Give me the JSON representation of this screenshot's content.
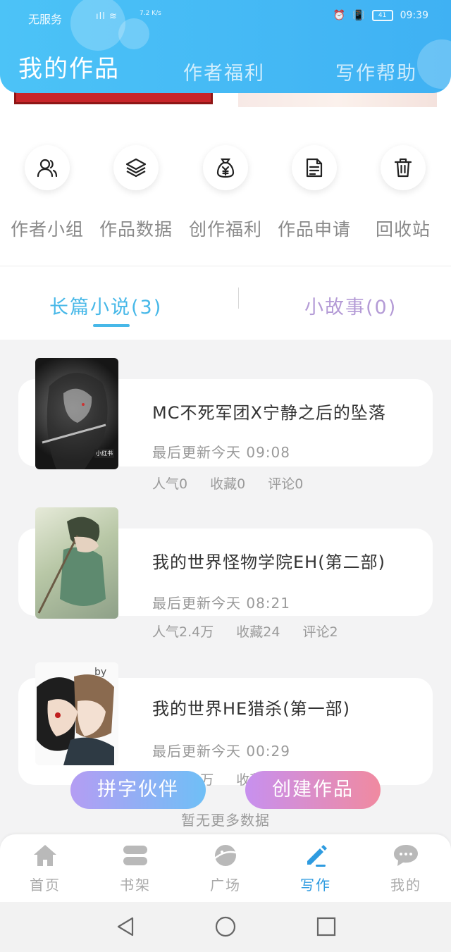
{
  "status_bar": {
    "carrier": "无服务",
    "signal": "ⁿ᯼ ≋",
    "speed": "7.2 K/s",
    "battery": "41",
    "time": "09:39"
  },
  "header": {
    "tabs": [
      "我的作品",
      "作者福利",
      "写作帮助"
    ],
    "active_tab": 0
  },
  "shortcuts": [
    {
      "label": "作者小组",
      "icon": "users-icon"
    },
    {
      "label": "作品数据",
      "icon": "layers-icon"
    },
    {
      "label": "创作福利",
      "icon": "money-bag-icon"
    },
    {
      "label": "作品申请",
      "icon": "document-icon"
    },
    {
      "label": "回收站",
      "icon": "trash-icon"
    }
  ],
  "type_tabs": {
    "long": "长篇小说(3)",
    "short": "小故事(0)",
    "active": "long"
  },
  "works": [
    {
      "title": "MC不死军团X宁静之后的坠落",
      "updated": "最后更新今天 09:08",
      "popularity": "人气0",
      "favorites": "收藏0",
      "comments": "评论0",
      "cover_tag": "小红书"
    },
    {
      "title": "我的世界怪物学院EH(第二部)",
      "updated": "最后更新今天 08:21",
      "popularity": "人气2.4万",
      "favorites": "收藏24",
      "comments": "评论2"
    },
    {
      "title": "我的世界HE猎杀(第一部)",
      "updated": "最后更新今天 00:29",
      "popularity": "人气2.2万",
      "favorites": "收藏",
      "comments": "",
      "cover_text": "by"
    }
  ],
  "actions": {
    "partner": "拼字伙伴",
    "create": "创建作品"
  },
  "no_more": "暂无更多数据",
  "tabbar": [
    {
      "label": "首页",
      "icon": "home-icon"
    },
    {
      "label": "书架",
      "icon": "bookshelf-icon"
    },
    {
      "label": "广场",
      "icon": "planet-icon"
    },
    {
      "label": "写作",
      "icon": "pen-icon"
    },
    {
      "label": "我的",
      "icon": "chat-icon"
    }
  ],
  "tabbar_active": 3,
  "colors": {
    "header": "#3fb1f3",
    "accent": "#47b8e8",
    "active_tab": "#2e9be0"
  }
}
